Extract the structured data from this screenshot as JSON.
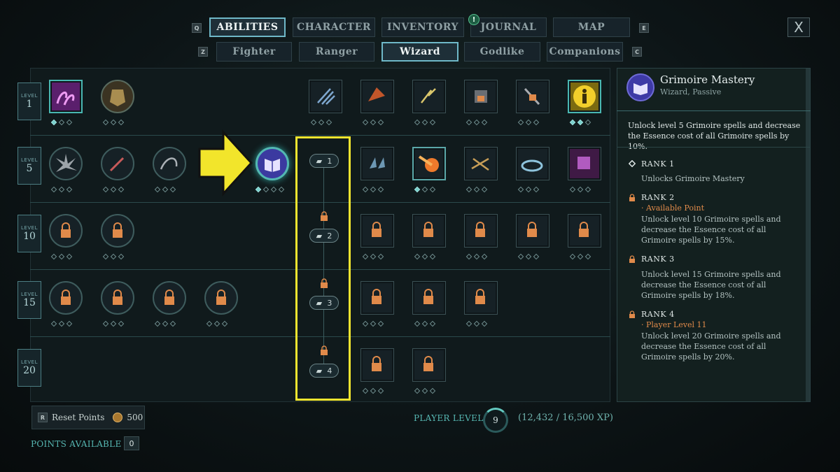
{
  "tabs": {
    "main": [
      {
        "label": "ABILITIES",
        "active": true
      },
      {
        "label": "CHARACTER",
        "active": false
      },
      {
        "label": "INVENTORY",
        "active": false
      },
      {
        "label": "JOURNAL",
        "active": false
      },
      {
        "label": "MAP",
        "active": false
      }
    ],
    "sub": [
      {
        "label": "Fighter",
        "active": false
      },
      {
        "label": "Ranger",
        "active": false
      },
      {
        "label": "Wizard",
        "active": true
      },
      {
        "label": "Godlike",
        "active": false
      },
      {
        "label": "Companions",
        "active": false
      }
    ],
    "keys": {
      "prev_main": "Q",
      "next_main": "E",
      "prev_sub": "Z",
      "next_sub": "C"
    },
    "journal_badge": "!",
    "close": "X"
  },
  "levels": [
    {
      "caption": "LEVEL",
      "value": "1"
    },
    {
      "caption": "LEVEL",
      "value": "5"
    },
    {
      "caption": "LEVEL",
      "value": "10"
    },
    {
      "caption": "LEVEL",
      "value": "15"
    },
    {
      "caption": "LEVEL",
      "value": "20"
    }
  ],
  "ranks_chain": [
    "1",
    "2",
    "3",
    "4"
  ],
  "bottom": {
    "reset_key": "R",
    "reset_label": "Reset Points",
    "reset_cost": "500",
    "points_label": "POINTS AVAILABLE",
    "points_value": "0",
    "player_level_label": "PLAYER LEVEL",
    "player_level_value": "9",
    "xp": "(12,432 / 16,500 XP)"
  },
  "detail": {
    "title": "Grimoire Mastery",
    "subtitle": "Wizard, Passive",
    "description": "Unlock level 5 Grimoire spells and decrease the Essence cost of all Grimoire spells by 10%.",
    "ranks": [
      {
        "title": "RANK 1",
        "note": "",
        "body": "Unlocks Grimoire Mastery"
      },
      {
        "title": "RANK 2",
        "note": "· Available Point",
        "body": "Unlock level 10 Grimoire spells and decrease the Essence cost of all Grimoire spells by 15%."
      },
      {
        "title": "RANK 3",
        "note": "",
        "body": "Unlock level 15 Grimoire spells and decrease the Essence cost of all Grimoire spells by 18%."
      },
      {
        "title": "RANK 4",
        "note": "· Player Level 11",
        "body": "Unlock level 20 Grimoire spells and decrease the Essence cost of all Grimoire spells by 20%."
      }
    ]
  },
  "colors": {
    "accent": "#56b7b2",
    "highlight": "#f1e52f",
    "locked": "#e08a4a",
    "selected": "#3e3aa6"
  }
}
